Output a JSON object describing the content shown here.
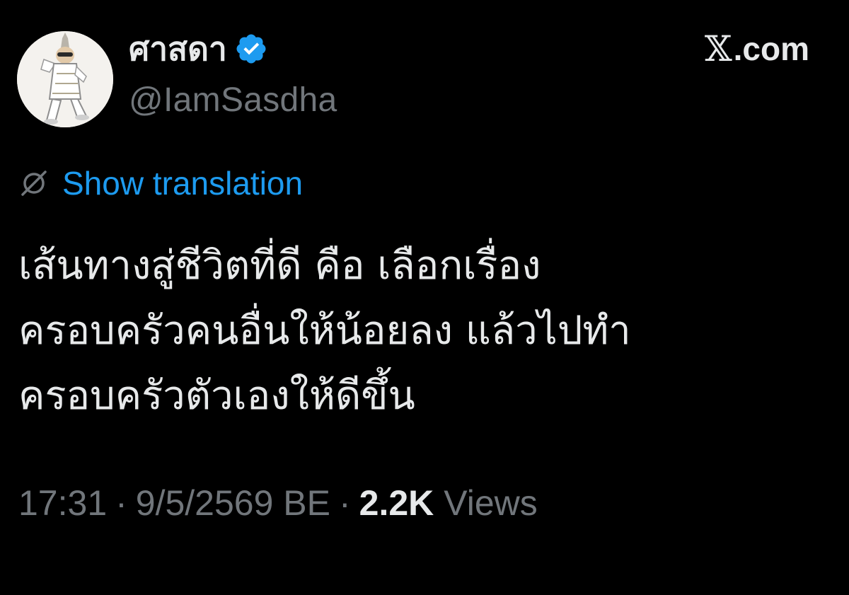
{
  "author": {
    "display_name": "ศาสดา",
    "handle": "@IamSasdha",
    "verified": true,
    "avatar_icon": "avatar-figure-icon"
  },
  "site": {
    "label": ".com",
    "logo_icon": "x-logo-icon"
  },
  "translation": {
    "label": "Show translation",
    "icon": "globe-icon",
    "color": "#1d9bf0"
  },
  "tweet": {
    "lines": [
      "เส้นทางสู่ชีวิตที่ดี คือ เลือกเรื่อง",
      "ครอบครัวคนอื่นให้น้อยลง แล้วไปทำ",
      "ครอบครัวตัวเองให้ดีขึ้น"
    ]
  },
  "meta": {
    "time": "17:31",
    "separator": "·",
    "date": "9/5/2569 BE",
    "views_count": "2.2K",
    "views_label": "Views"
  },
  "colors": {
    "background": "#000000",
    "text_primary": "#e7e9ea",
    "text_secondary": "#71767b",
    "verified_badge": "#1d9bf0"
  }
}
